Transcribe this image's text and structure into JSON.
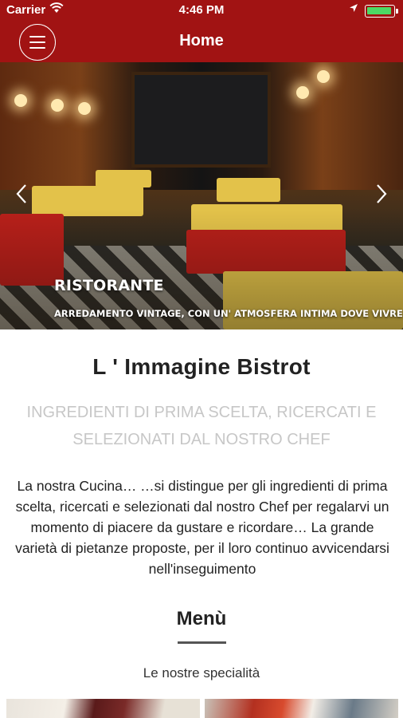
{
  "status_bar": {
    "carrier": "Carrier",
    "time": "4:46 PM",
    "wifi_icon": "wifi-icon",
    "location_icon": "location-arrow-icon",
    "battery_icon": "battery-icon"
  },
  "nav": {
    "title": "Home",
    "menu_icon": "hamburger-menu-icon",
    "background_color": "#a11313"
  },
  "hero": {
    "title": "RISTORANTE",
    "subtitle": "ARREDAMENTO VINTAGE, CON UN' ATMOSFERA INTIMA DOVE VIVRE...",
    "prev_icon": "chevron-left-icon",
    "next_icon": "chevron-right-icon"
  },
  "restaurant": {
    "name": "L ' Immagine Bistrot",
    "tagline": "INGREDIENTI DI PRIMA SCELTA, RICERCATI E SELEZIONATI DAL NOSTRO CHEF",
    "intro": "La nostra Cucina… …si distingue per gli ingredienti di prima scelta, ricercati e selezionati dal nostro Chef per regalarvi un momento di piacere da gustare e ricordare… La grande varietà di pietanze proposte, per il loro continuo avvicendarsi nell'inseguimento"
  },
  "menu_section": {
    "title": "Menù",
    "subtitle": "Le nostre specialità"
  }
}
